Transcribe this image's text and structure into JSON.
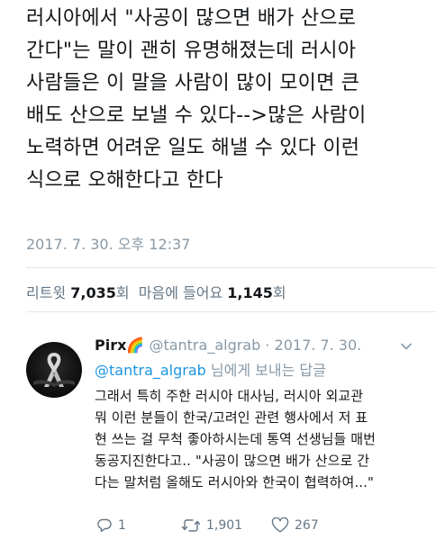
{
  "tweet": {
    "lines": [
      "러시아에서 \"사공이 많으면 배가 산으로",
      "간다\"는 말이 괜히 유명해졌는데 러시아",
      "사람들은 이 말을 사람이 많이 모이면 큰",
      "배도 산으로 보낼 수 있다-->많은 사람이",
      "노력하면 어려운 일도 해낼 수 있다 이런",
      "식으로 오해한다고 한다"
    ],
    "timestamp": "2017. 7. 30. 오후 12:37"
  },
  "stats": {
    "retweets_label": "리트윗",
    "retweets_count": "7,035",
    "retweets_unit": "회",
    "likes_label": "마음에 들어요",
    "likes_count": "1,145",
    "likes_unit": "회"
  },
  "reply": {
    "name": "Pirx🌈",
    "handle": "@tantra_algrab",
    "separator": "·",
    "date": "2017. 7. 30.",
    "reply_to_mention": "@tantra_algrab",
    "reply_to_suffix": "님에게 보내는 답글",
    "lines": [
      "그래서 특히 주한 러시아 대사님, 러시아 외교관",
      "뭐 이런 분들이 한국/고려인 관련 행사에서 저 표",
      "현 쓰는 걸 무척 좋아하시는데 통역 선생님들 매번",
      "동공지진한다고.. \"사공이 많으면 배가 산으로 간",
      "다는 말처럼 올해도 러시아와 한국이 협력하여...\""
    ],
    "actions": {
      "replies": "1",
      "retweets": "1,901",
      "likes": "267"
    }
  },
  "colors": {
    "text": "#14171a",
    "muted": "#8899a6",
    "link": "#1b95e0",
    "divider": "#e1e8ed"
  },
  "icons": [
    "reply-icon",
    "retweet-icon",
    "heart-icon",
    "caret-down-icon"
  ]
}
